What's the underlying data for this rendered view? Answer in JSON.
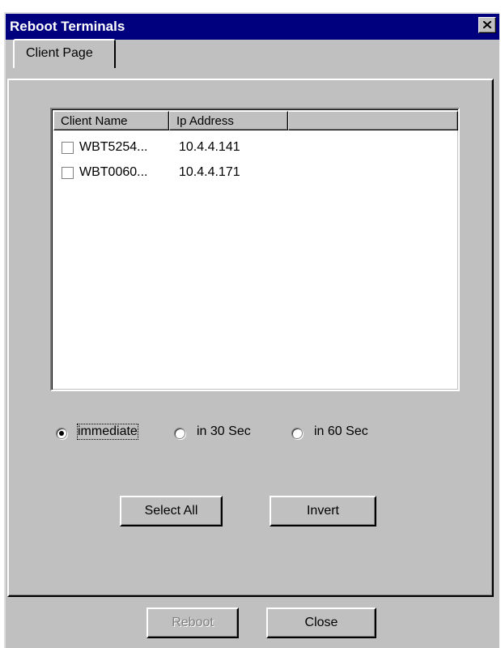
{
  "window": {
    "title": "Reboot Terminals"
  },
  "tabs": [
    {
      "label": "Client Page"
    }
  ],
  "listview": {
    "columns": [
      "Client Name",
      "Ip Address"
    ],
    "rows": [
      {
        "name": "WBT5254...",
        "ip": "10.4.4.141",
        "checked": false
      },
      {
        "name": "WBT0060...",
        "ip": "10.4.4.171",
        "checked": false
      }
    ]
  },
  "timing": {
    "options": [
      "immediate",
      "in 30 Sec",
      "in 60 Sec"
    ],
    "selected": "immediate"
  },
  "buttons": {
    "select_all": "Select All",
    "invert": "Invert",
    "reboot": "Reboot",
    "close": "Close"
  },
  "icons": {
    "close": "close-x-icon"
  },
  "colors": {
    "titlebar": "#00007f",
    "face": "#c0c0c0"
  }
}
